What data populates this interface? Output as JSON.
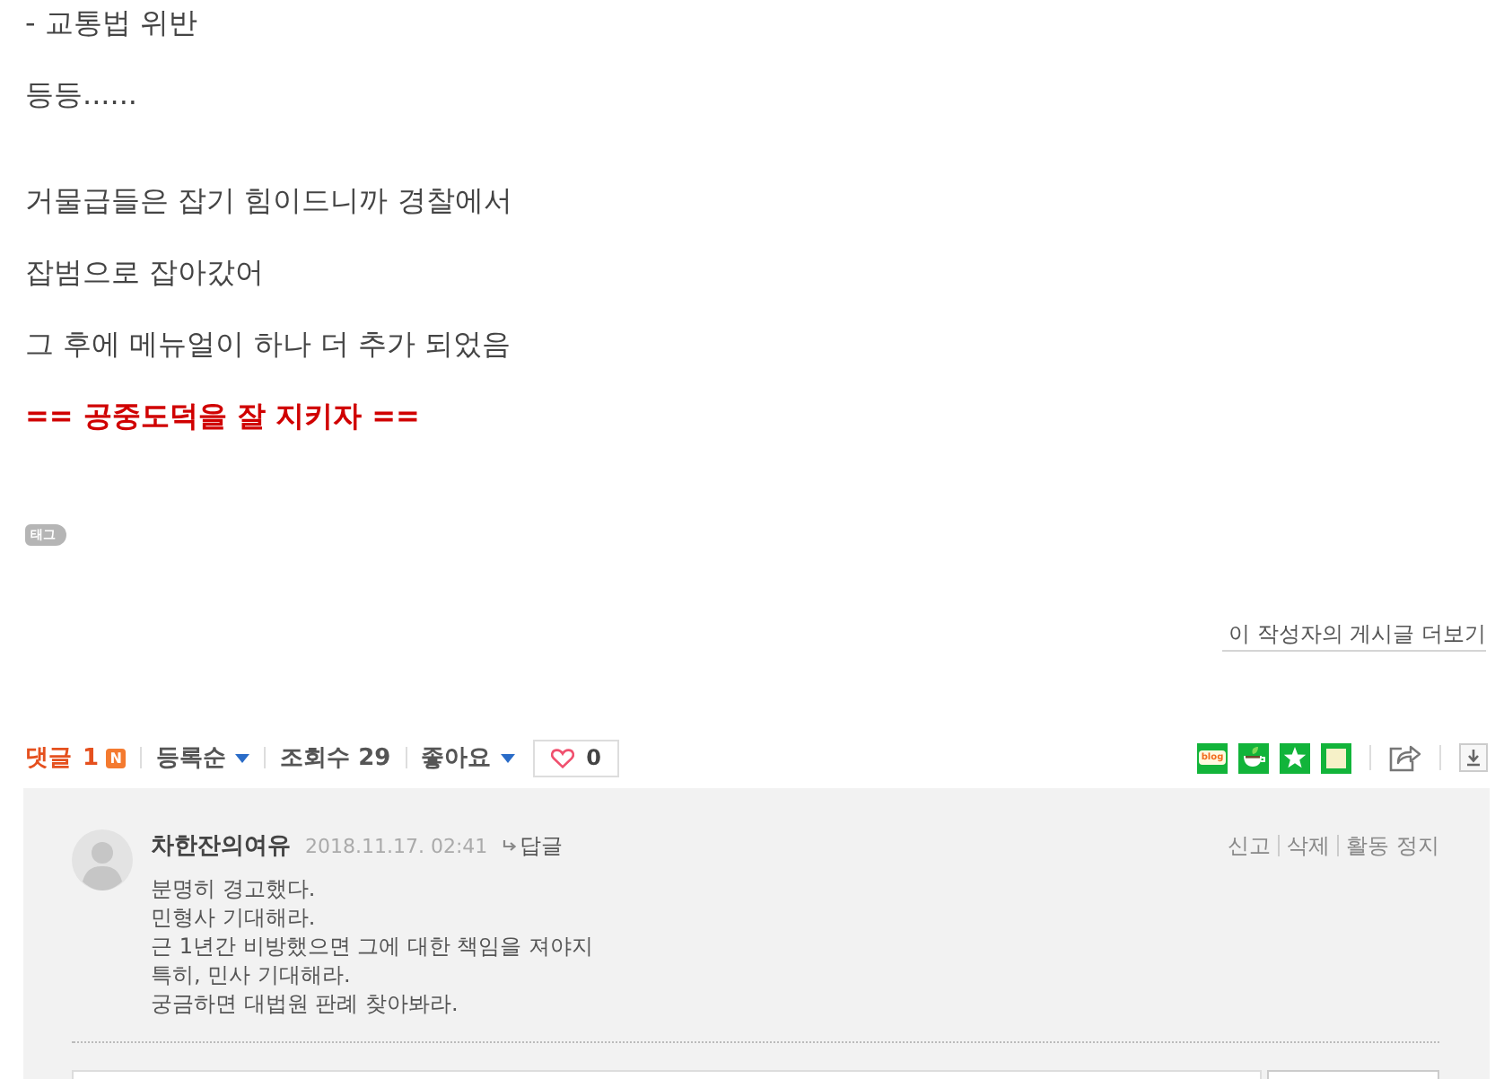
{
  "post": {
    "sections": [
      {
        "paragraphs": [
          {
            "text": "- 교통법 위반",
            "emphasis": false
          },
          {
            "text": "등등......",
            "emphasis": false
          }
        ]
      },
      {
        "paragraphs": [
          {
            "text": "거물급들은 잡기 힘이드니까 경찰에서",
            "emphasis": false
          },
          {
            "text": "잡범으로 잡아갔어",
            "emphasis": false
          },
          {
            "text": "그 후에 메뉴얼이 하나 더 추가 되었음",
            "emphasis": false
          },
          {
            "text": "== 공중도덕을 잘 지키자 ==",
            "emphasis": true
          }
        ]
      }
    ],
    "tag_label": "태그",
    "more_link": "이 작성자의 게시글 더보기"
  },
  "comment_bar": {
    "title": "댓글",
    "count": "1",
    "new_badge": "N",
    "sort": "등록순",
    "views_label": "조회수",
    "views": "29",
    "likes_label": "좋아요",
    "liked": false,
    "like_count": "0"
  },
  "share_buttons": [
    {
      "kind": "blog",
      "label": "blog"
    },
    {
      "kind": "cafe"
    },
    {
      "kind": "bookmark"
    },
    {
      "kind": "memo"
    }
  ],
  "tools": [
    {
      "kind": "share"
    },
    {
      "kind": "save"
    }
  ],
  "comments": [
    {
      "author": "차한잔의여유",
      "date": "2018.11.17. 02:41",
      "reply": "답글",
      "actions": [
        "신고",
        "삭제",
        "활동 정지"
      ],
      "text": "분명히 경고했다.\n민형사 기대해라.\n근 1년간 비방했으면 그에 대한 책임을 져야지\n특히, 민사 기대해라.\n궁금하면 대법원 판례 찾아봐라."
    }
  ]
}
